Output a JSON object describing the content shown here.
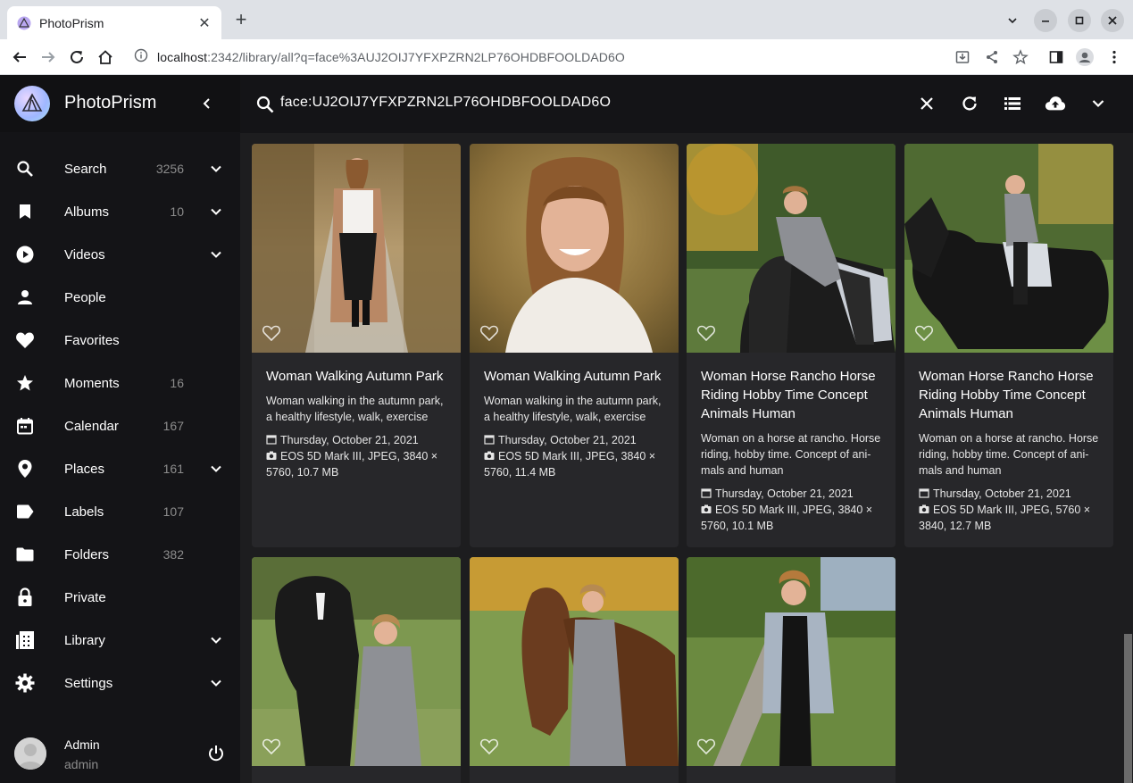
{
  "browser": {
    "tab_title": "PhotoPrism",
    "url_host": "localhost",
    "url_path": ":2342/library/all?q=face%3AUJ2OIJ7YFXPZRN2LP76OHDBFOOLDAD6O"
  },
  "app": {
    "brand": "PhotoPrism",
    "query": "face:UJ2OIJ7YFXPZRN2LP76OHDBFOOLDAD6O"
  },
  "nav": [
    {
      "label": "Search",
      "count": "3256",
      "icon": "search-icon",
      "expand": true
    },
    {
      "label": "Albums",
      "count": "10",
      "icon": "bookmark-icon",
      "expand": true
    },
    {
      "label": "Videos",
      "count": "",
      "icon": "play-circle-icon",
      "expand": true
    },
    {
      "label": "People",
      "count": "",
      "icon": "person-icon",
      "expand": false
    },
    {
      "label": "Favorites",
      "count": "",
      "icon": "heart-icon",
      "expand": false
    },
    {
      "label": "Moments",
      "count": "16",
      "icon": "star-icon",
      "expand": false
    },
    {
      "label": "Calendar",
      "count": "167",
      "icon": "calendar-icon",
      "expand": false
    },
    {
      "label": "Places",
      "count": "161",
      "icon": "place-icon",
      "expand": true
    },
    {
      "label": "Labels",
      "count": "107",
      "icon": "label-icon",
      "expand": false
    },
    {
      "label": "Folders",
      "count": "382",
      "icon": "folder-icon",
      "expand": false
    },
    {
      "label": "Private",
      "count": "",
      "icon": "lock-icon",
      "expand": false
    },
    {
      "label": "Library",
      "count": "",
      "icon": "library-icon",
      "expand": true
    },
    {
      "label": "Settings",
      "count": "",
      "icon": "gear-icon",
      "expand": true
    }
  ],
  "user": {
    "name": "Admin",
    "login": "admin"
  },
  "cards": [
    {
      "title": "Woman Walking Autumn Park",
      "desc": "Woman walking in the autumn park, a healthy lifestyle, walk, exercise",
      "date": "Thursday, October 21, 2021",
      "camera": "EOS 5D Mark III, JPEG, 3840 × 5760, 10.7 MB"
    },
    {
      "title": "Woman Walking Autumn Park",
      "desc": "Woman walking in the autumn park, a healthy lifestyle, walk, exercise",
      "date": "Thursday, October 21, 2021",
      "camera": "EOS 5D Mark III, JPEG, 3840 × 5760, 11.4 MB"
    },
    {
      "title": "Woman Horse Rancho Horse Riding Hobby Time Concept Animals Human",
      "desc": "Woman on a horse at rancho. Horse riding, hobby time. Concept of ani-mals and human",
      "date": "Thursday, October 21, 2021",
      "camera": "EOS 5D Mark III, JPEG, 3840 × 5760, 10.1 MB"
    },
    {
      "title": "Woman Horse Rancho Horse Riding Hobby Time Concept Animals Human",
      "desc": "Woman on a horse at rancho. Horse riding, hobby time. Concept of ani-mals and human",
      "date": "Thursday, October 21, 2021",
      "camera": "EOS 5D Mark III, JPEG, 5760 × 3840, 12.7 MB"
    }
  ],
  "colors": {
    "sidebar": "#141417",
    "content": "#1d1d1f",
    "card": "#27272a"
  }
}
